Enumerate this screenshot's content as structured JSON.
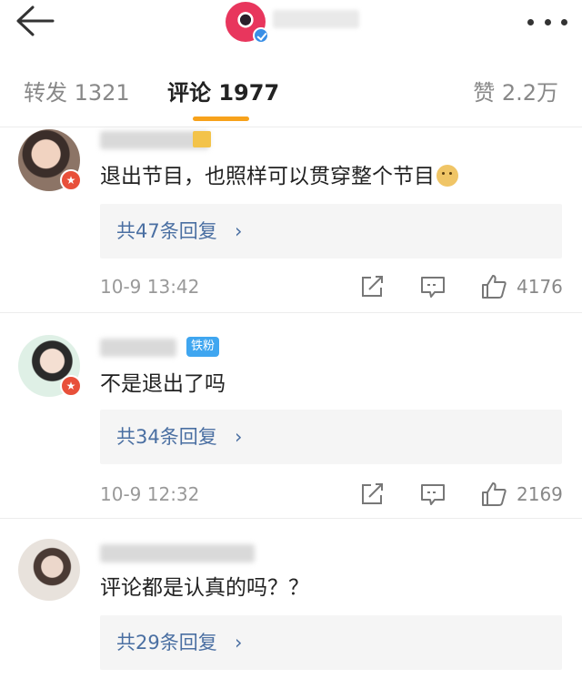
{
  "header": {
    "back_icon": "arrow-left-icon",
    "more_icon": "more-dots-icon"
  },
  "tabs": {
    "repost": "转发 1321",
    "comment": "评论 1977",
    "like": "赞 2.2万",
    "active": "comment",
    "accent_color": "#f7a21b"
  },
  "comments": [
    {
      "text": "退出节目，也照样可以贯穿整个节目",
      "replies": "共47条回复",
      "time": "10-9 13:42",
      "likes": "4176"
    },
    {
      "badge": "铁粉",
      "text": "不是退出了吗",
      "replies": "共34条回复",
      "time": "10-9 12:32",
      "likes": "2169"
    },
    {
      "text": "评论都是认真的吗？？",
      "replies": "共29条回复"
    }
  ],
  "reply_chevron": "›",
  "link_color": "#4a6fa2"
}
